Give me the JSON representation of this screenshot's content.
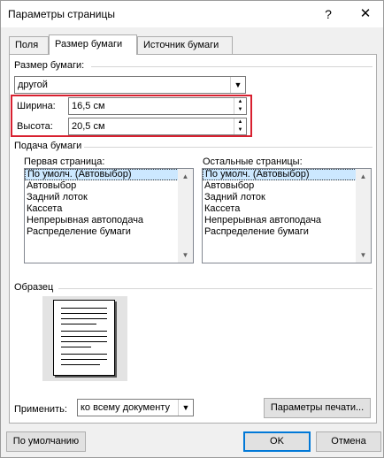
{
  "window": {
    "title": "Параметры страницы",
    "help_glyph": "?",
    "close_glyph": "✕"
  },
  "tabs": [
    {
      "label": "Поля",
      "active": false
    },
    {
      "label": "Размер бумаги",
      "active": true
    },
    {
      "label": "Источник бумаги",
      "active": false
    }
  ],
  "paper_size": {
    "label": "Размер бумаги:",
    "selected": "другой",
    "width_label": "Ширина:",
    "width_value": "16,5 см",
    "height_label": "Высота:",
    "height_value": "20,5 см"
  },
  "paper_feed": {
    "label": "Подача бумаги",
    "first_page_label": "Первая страница:",
    "other_pages_label": "Остальные страницы:",
    "first_page_items": [
      "По умолч. (Автовыбор)",
      "Автовыбор",
      "Задний лоток",
      "Кассета",
      "Непрерывная автоподача",
      "Распределение бумаги"
    ],
    "other_pages_items": [
      "По умолч. (Автовыбор)",
      "Автовыбор",
      "Задний лоток",
      "Кассета",
      "Непрерывная автоподача",
      "Распределение бумаги"
    ]
  },
  "preview": {
    "label": "Образец"
  },
  "apply": {
    "label": "Применить:",
    "selected": "ко всему документу"
  },
  "buttons": {
    "print_options": "Параметры печати...",
    "default": "По умолчанию",
    "ok": "OK",
    "cancel": "Отмена"
  },
  "icons": {
    "dropdown": "▼",
    "spin_up": "▲",
    "spin_down": "▼",
    "scroll_up": "▲",
    "scroll_down": "▼"
  },
  "colors": {
    "highlight_box": "#d8202f",
    "selection": "#cce8ff"
  }
}
